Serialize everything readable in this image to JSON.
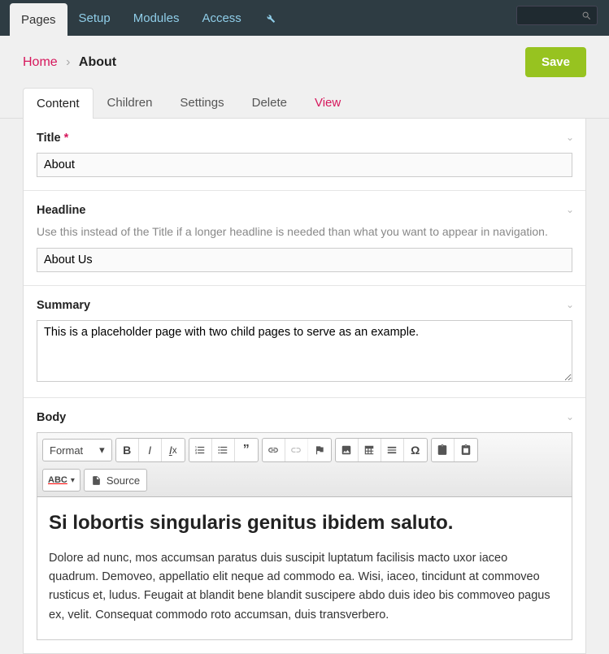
{
  "topnav": {
    "tabs": [
      "Pages",
      "Setup",
      "Modules",
      "Access"
    ],
    "active_index": 0
  },
  "breadcrumb": {
    "home": "Home",
    "current": "About"
  },
  "save_button": "Save",
  "content_tabs": {
    "items": [
      "Content",
      "Children",
      "Settings",
      "Delete",
      "View"
    ],
    "active_index": 0
  },
  "fields": {
    "title": {
      "label": "Title",
      "value": "About"
    },
    "headline": {
      "label": "Headline",
      "help": "Use this instead of the Title if a longer headline is needed than what you want to appear in navigation.",
      "value": "About Us"
    },
    "summary": {
      "label": "Summary",
      "value": "This is a placeholder page with two child pages to serve as an example."
    },
    "body": {
      "label": "Body",
      "format_label": "Format",
      "source_label": "Source",
      "content_heading": "Si lobortis singularis genitus ibidem saluto.",
      "content_para": "Dolore ad nunc, mos accumsan paratus duis suscipit luptatum facilisis macto uxor iaceo quadrum. Demoveo, appellatio elit neque ad commodo ea. Wisi, iaceo, tincidunt at commoveo rusticus et, ludus. Feugait at blandit bene blandit suscipere abdo duis ideo bis commoveo pagus ex, velit. Consequat commodo roto accumsan, duis transverbero."
    }
  }
}
